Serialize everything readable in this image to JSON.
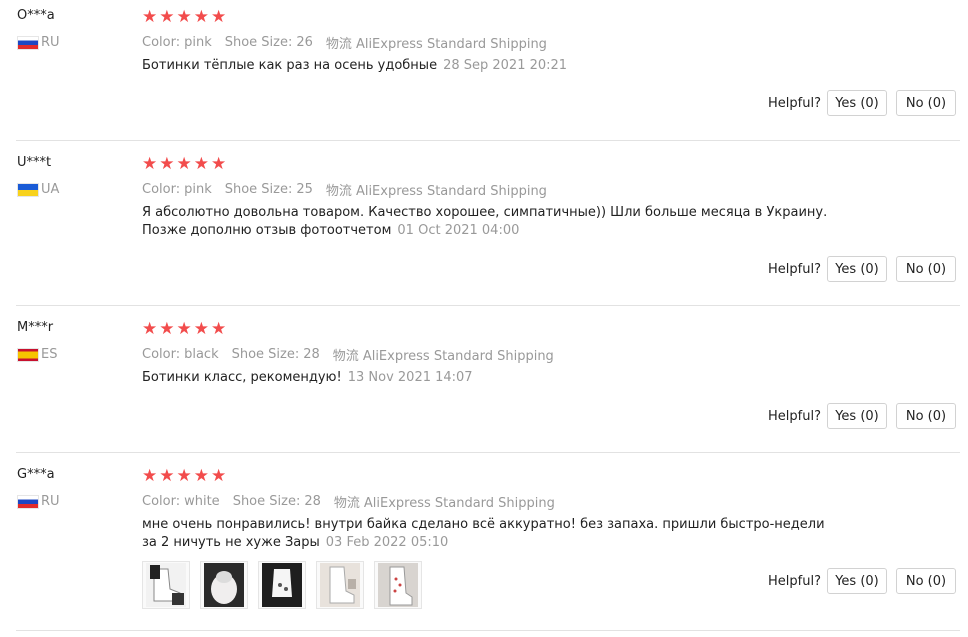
{
  "helpful_label": "Helpful?",
  "reviews": [
    {
      "user": "O***a",
      "country": "RU",
      "stars": 5,
      "color_label": "Color:",
      "color": "pink",
      "size_label": "Shoe Size:",
      "size": "26",
      "shipping_label": "物流",
      "shipping": "AliExpress Standard Shipping",
      "text": "Ботинки тёплые как раз на осень удобные",
      "date": "28 Sep 2021 20:21",
      "yes": "Yes (0)",
      "no": "No (0)"
    },
    {
      "user": "U***t",
      "country": "UA",
      "stars": 5,
      "color_label": "Color:",
      "color": "pink",
      "size_label": "Shoe Size:",
      "size": "25",
      "shipping_label": "物流",
      "shipping": "AliExpress Standard Shipping",
      "text": "Я абсолютно довольна товаром. Качество хорошее, симпатичные)) Шли больше месяца в Украину. Позже дополню отзыв фотоотчетом",
      "date": "01 Oct 2021 04:00",
      "yes": "Yes (0)",
      "no": "No (0)"
    },
    {
      "user": "M***r",
      "country": "ES",
      "stars": 5,
      "color_label": "Color:",
      "color": "black",
      "size_label": "Shoe Size:",
      "size": "28",
      "shipping_label": "物流",
      "shipping": "AliExpress Standard Shipping",
      "text": "Ботинки класс, рекомендую!",
      "date": "13 Nov 2021 14:07",
      "yes": "Yes (0)",
      "no": "No (0)"
    },
    {
      "user": "G***a",
      "country": "RU",
      "stars": 5,
      "color_label": "Color:",
      "color": "white",
      "size_label": "Shoe Size:",
      "size": "28",
      "shipping_label": "物流",
      "shipping": "AliExpress Standard Shipping",
      "text": "мне очень понравились! внутри байка сделано всё аккуратно! без запаха. пришли быстро-недели за 2 ничуть не хуже Зары",
      "date": "03 Feb 2022 05:10",
      "yes": "Yes (0)",
      "no": "No (0)",
      "photos": [
        "boot-photo-icon",
        "boot-photo-icon",
        "boot-photo-icon",
        "boot-photo-icon",
        "boot-photo-icon"
      ]
    }
  ],
  "colors": {
    "star": "#f24c4c",
    "muted": "#999999",
    "border": "#d2d2d2"
  }
}
